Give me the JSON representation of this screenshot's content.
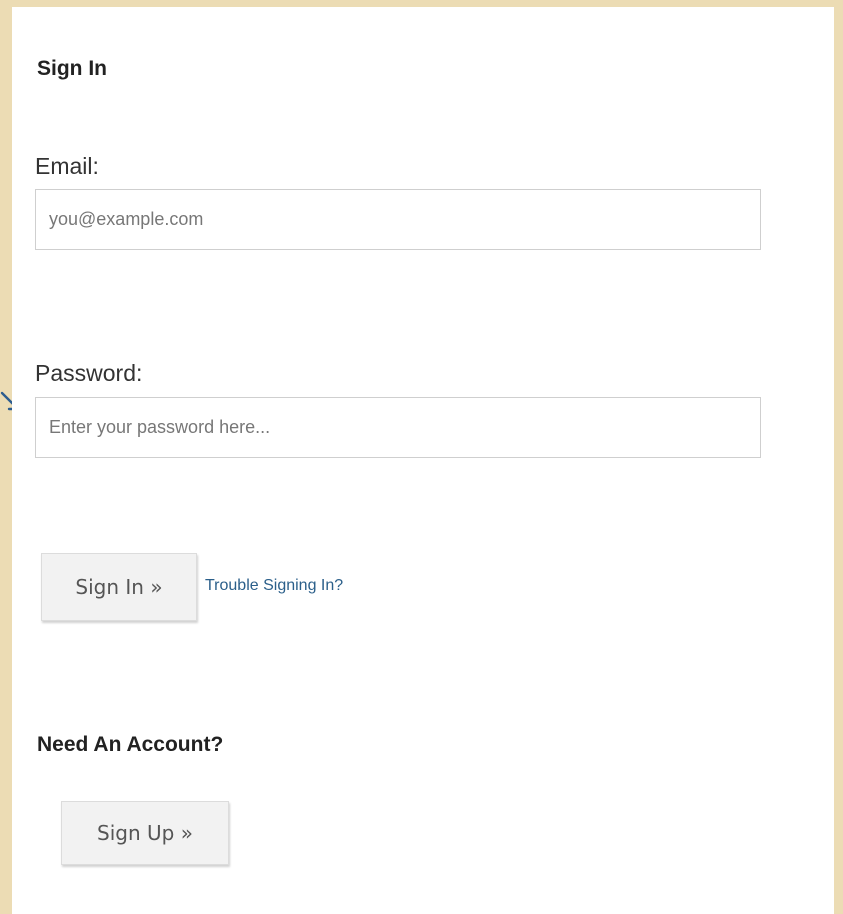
{
  "signin": {
    "title": "Sign In",
    "email_label": "Email:",
    "email_placeholder": "you@example.com",
    "password_label": "Password:",
    "password_placeholder": "Enter your password here...",
    "signin_button": "Sign In »",
    "trouble_link": "Trouble Signing In?"
  },
  "signup": {
    "title": "Need An Account?",
    "signup_button": "Sign Up »"
  },
  "icons": {
    "arrow": "arrow-down-right-icon"
  },
  "colors": {
    "background": "#ecdcb4",
    "link": "#2b5f8a",
    "arrow": "#2c5d8f"
  }
}
